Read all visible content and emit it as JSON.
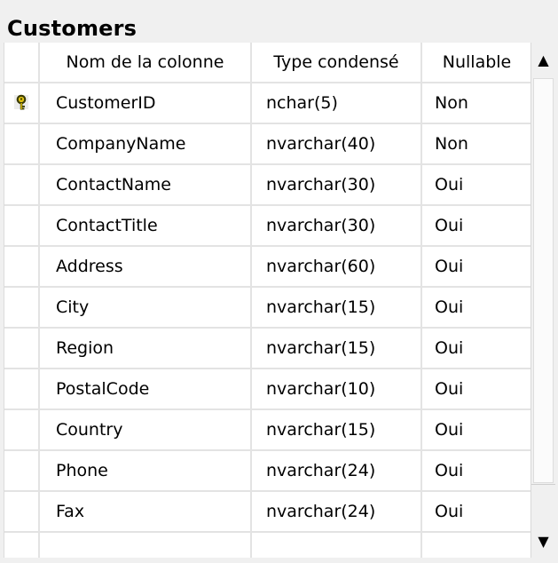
{
  "table": {
    "title": "Customers",
    "headers": {
      "name": "Nom de la colonne",
      "type": "Type condensé",
      "nullable": "Nullable"
    },
    "rows": [
      {
        "name": "CustomerID",
        "type": "nchar(5)",
        "nullable": "Non",
        "primary_key": true
      },
      {
        "name": "CompanyName",
        "type": "nvarchar(40)",
        "nullable": "Non"
      },
      {
        "name": "ContactName",
        "type": "nvarchar(30)",
        "nullable": "Oui"
      },
      {
        "name": "ContactTitle",
        "type": "nvarchar(30)",
        "nullable": "Oui"
      },
      {
        "name": "Address",
        "type": "nvarchar(60)",
        "nullable": "Oui"
      },
      {
        "name": "City",
        "type": "nvarchar(15)",
        "nullable": "Oui"
      },
      {
        "name": "Region",
        "type": "nvarchar(15)",
        "nullable": "Oui"
      },
      {
        "name": "PostalCode",
        "type": "nvarchar(10)",
        "nullable": "Oui"
      },
      {
        "name": "Country",
        "type": "nvarchar(15)",
        "nullable": "Oui"
      },
      {
        "name": "Phone",
        "type": "nvarchar(24)",
        "nullable": "Oui"
      },
      {
        "name": "Fax",
        "type": "nvarchar(24)",
        "nullable": "Oui"
      },
      {
        "name": "",
        "type": "",
        "nullable": ""
      }
    ]
  },
  "icons": {
    "primary_key": "key-icon",
    "scroll_up": "arrow-up-icon",
    "scroll_down": "arrow-down-icon"
  },
  "colors": {
    "grid_line": "#e3e3e3",
    "key_icon": "#c9a800"
  }
}
